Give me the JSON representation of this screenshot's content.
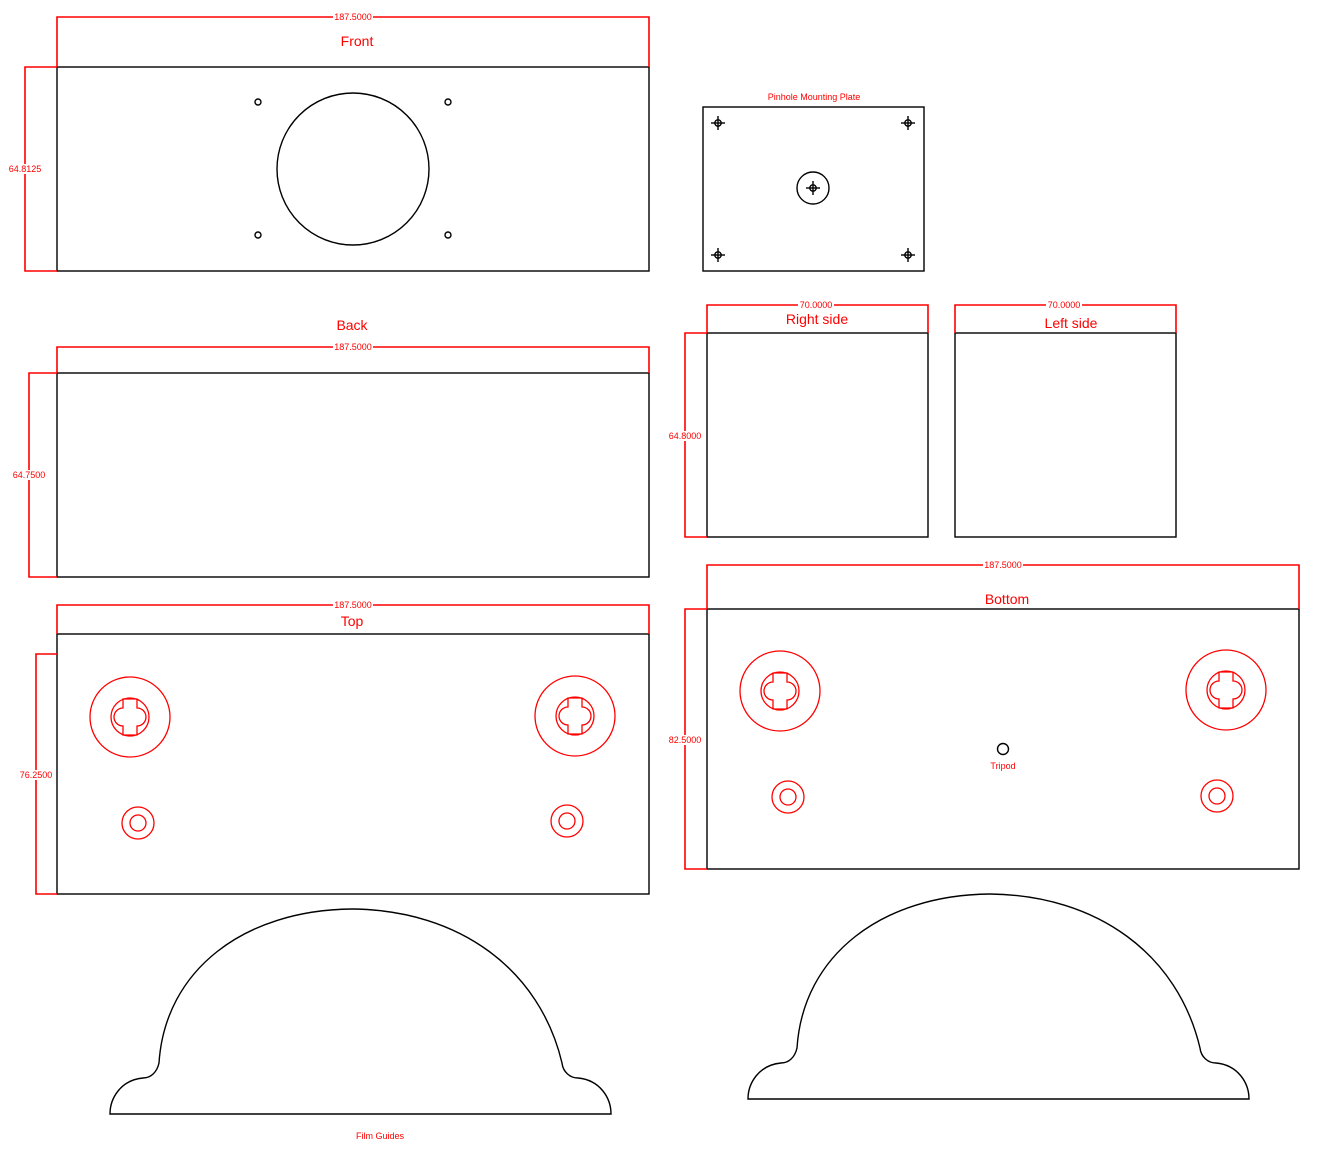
{
  "colors": {
    "dimension": "#ff0000",
    "outline": "#000000",
    "background": "#ffffff"
  },
  "panels": {
    "front": {
      "title": "Front",
      "width_dim": "187.5000",
      "height_dim": "64.8125"
    },
    "pinhole_plate": {
      "title": "Pinhole Mounting Plate"
    },
    "back": {
      "title": "Back",
      "width_dim": "187.5000",
      "height_dim": "64.7500"
    },
    "right_side": {
      "title": "Right side",
      "width_dim": "70.0000",
      "height_dim": "64.8000"
    },
    "left_side": {
      "title": "Left side",
      "width_dim": "70.0000"
    },
    "top": {
      "title": "Top",
      "width_dim": "187.5000",
      "height_dim": "76.2500"
    },
    "bottom": {
      "title": "Bottom",
      "width_dim": "187.5000",
      "height_dim": "82.5000",
      "tripod_label": "Tripod"
    },
    "film_guides": {
      "title": "Film Guides"
    }
  }
}
